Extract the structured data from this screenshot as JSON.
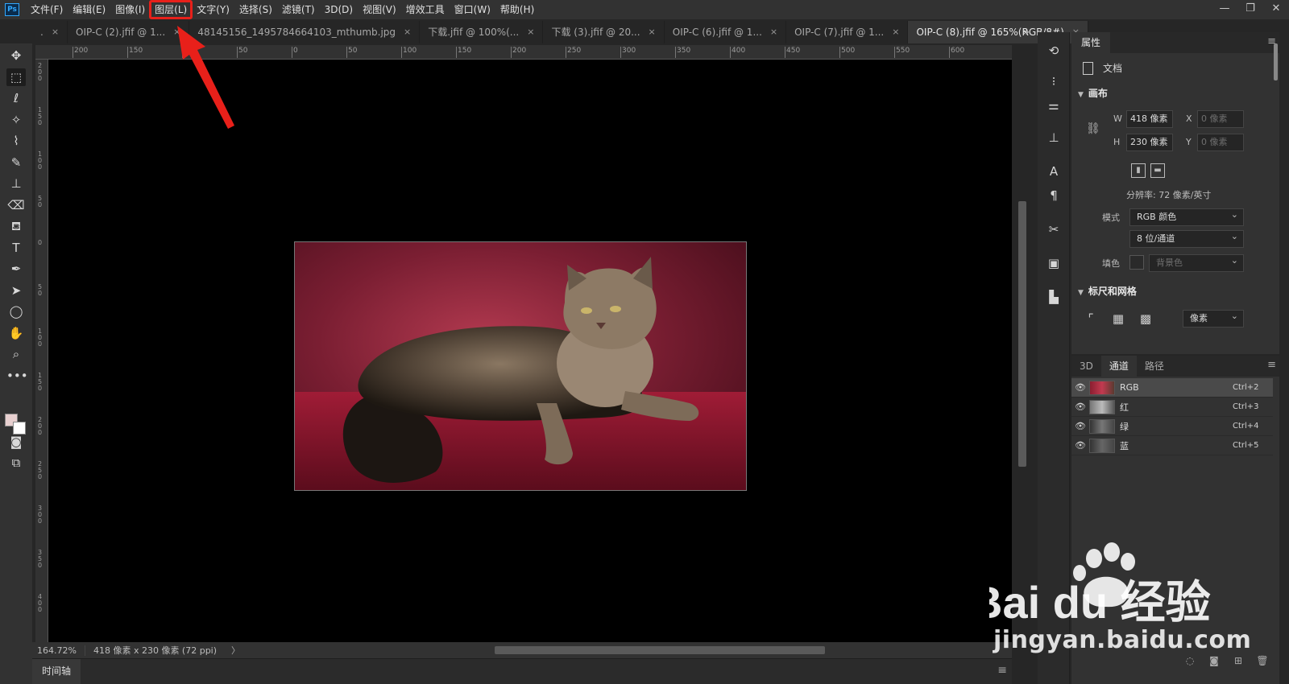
{
  "menubar": {
    "logo": "Ps",
    "items": [
      "文件(F)",
      "编辑(E)",
      "图像(I)",
      "图层(L)",
      "文字(Y)",
      "选择(S)",
      "滤镜(T)",
      "3D(D)",
      "视图(V)",
      "增效工具",
      "窗口(W)",
      "帮助(H)"
    ],
    "highlighted_item": "图层(L)",
    "window_controls": [
      "—",
      "❐",
      "✕"
    ]
  },
  "tabs": [
    {
      "label": ".",
      "active": false
    },
    {
      "label": "OIP-C (2).jfif @ 1...",
      "active": false
    },
    {
      "label": "48145156_1495784664103_mthumb.jpg",
      "active": false
    },
    {
      "label": "下载.jfif @ 100%(...",
      "active": false
    },
    {
      "label": "下载 (3).jfif @ 20...",
      "active": false
    },
    {
      "label": "OIP-C (6).jfif @ 1...",
      "active": false
    },
    {
      "label": "OIP-C (7).jfif @ 1...",
      "active": false
    },
    {
      "label": "OIP-C (8).jfif @ 165%(RGB/8#)",
      "active": true
    }
  ],
  "tab_close": "×",
  "tab_overflow": "»",
  "ruler": {
    "top_labels": [
      "200",
      "150",
      "100",
      "50",
      "0",
      "50",
      "100",
      "150",
      "200",
      "250",
      "300",
      "350",
      "400",
      "450",
      "500",
      "550",
      "600"
    ],
    "left_labels": [
      "2\n0\n0",
      "1\n5\n0",
      "1\n0\n0",
      "5\n0",
      "0",
      "5\n0",
      "1\n0\n0",
      "1\n5\n0",
      "2\n0\n0",
      "2\n5\n0",
      "3\n0\n0",
      "3\n5\n0",
      "4\n0\n0"
    ]
  },
  "toolbar": {
    "tools": [
      {
        "name": "move-tool",
        "glyph": "✥"
      },
      {
        "name": "marquee-tool",
        "glyph": "⬚"
      },
      {
        "name": "lasso-tool",
        "glyph": "ℓ"
      },
      {
        "name": "magic-wand-tool",
        "glyph": "✧"
      },
      {
        "name": "eyedropper-tool",
        "glyph": "⌇"
      },
      {
        "name": "brush-tool",
        "glyph": "✎"
      },
      {
        "name": "stamp-tool",
        "glyph": "⊥"
      },
      {
        "name": "eraser-tool",
        "glyph": "⌫"
      },
      {
        "name": "paint-bucket-tool",
        "glyph": "⛾"
      },
      {
        "name": "type-tool",
        "glyph": "T"
      },
      {
        "name": "pen-tool",
        "glyph": "✒"
      },
      {
        "name": "path-selection-tool",
        "glyph": "➤"
      },
      {
        "name": "ellipse-tool",
        "glyph": "◯"
      },
      {
        "name": "hand-tool",
        "glyph": "✋"
      },
      {
        "name": "zoom-tool",
        "glyph": "⌕"
      },
      {
        "name": "more-tools",
        "glyph": "•••"
      }
    ],
    "bottom_tools": [
      {
        "name": "quick-mask-tool",
        "glyph": "◙"
      },
      {
        "name": "screen-mode-tool",
        "glyph": "⧉"
      }
    ],
    "colors": {
      "foreground": "#e8d0d0",
      "background": "#ffffff"
    }
  },
  "statusbar": {
    "zoom": "164.72%",
    "info": "418 像素 x 230 像素 (72 ppi)",
    "arrow": "〉"
  },
  "timeline": {
    "label": "时间轴"
  },
  "icon_column": [
    {
      "name": "history-icon",
      "glyph": "⟲"
    },
    {
      "name": "brush-settings-icon",
      "glyph": "⁝"
    },
    {
      "name": "adjustments-icon",
      "glyph": "⚌"
    },
    {
      "name": "clone-source-icon",
      "glyph": "⊥"
    },
    {
      "name": "character-icon",
      "glyph": "A"
    },
    {
      "name": "paragraph-icon",
      "glyph": "¶"
    },
    {
      "name": "tools-icon",
      "glyph": "✂"
    },
    {
      "name": "properties-icon",
      "glyph": "▣"
    },
    {
      "name": "plugins-icon",
      "glyph": "▙"
    }
  ],
  "properties": {
    "tab": "属性",
    "doc_label": "文档",
    "canvas_section": "画布",
    "w_label": "W",
    "w_value": "418 像素",
    "h_label": "H",
    "h_value": "230 像素",
    "x_label": "X",
    "x_placeholder": "0 像素",
    "y_label": "Y",
    "y_placeholder": "0 像素",
    "resolution": "分辨率: 72 像素/英寸",
    "mode_label": "模式",
    "mode_value": "RGB 颜色",
    "depth_value": "8 位/通道",
    "fill_label": "填色",
    "fill_value": "背景色",
    "rulers_section": "标尺和网格",
    "units_value": "像素"
  },
  "channels": {
    "tabs": [
      "3D",
      "通道",
      "路径"
    ],
    "active_tab": "通道",
    "rows": [
      {
        "name": "RGB",
        "shortcut": "Ctrl+2",
        "selected": true
      },
      {
        "name": "红",
        "shortcut": "Ctrl+3",
        "selected": false
      },
      {
        "name": "绿",
        "shortcut": "Ctrl+4",
        "selected": false
      },
      {
        "name": "蓝",
        "shortcut": "Ctrl+5",
        "selected": false
      }
    ]
  },
  "watermark": {
    "logo": "Bai du 经验",
    "url": "jingyan.baidu.com"
  },
  "colors": {
    "accent_red": "#e8201a",
    "ps_blue": "#31a8ff"
  }
}
